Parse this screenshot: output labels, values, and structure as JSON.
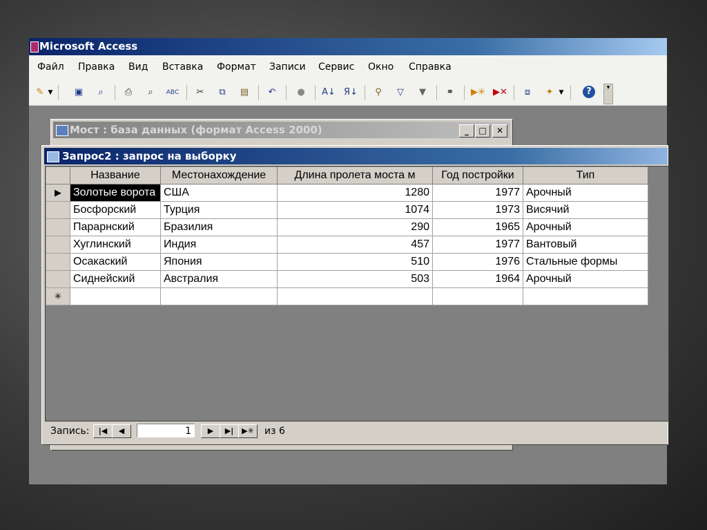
{
  "app": {
    "title": "Microsoft Access"
  },
  "menu": [
    "Файл",
    "Правка",
    "Вид",
    "Вставка",
    "Формат",
    "Записи",
    "Сервис",
    "Окно",
    "Справка"
  ],
  "toolbar": {
    "icons": [
      "design-view-icon",
      "save-icon",
      "search-icon",
      "print-icon",
      "print-preview-icon",
      "spelling-icon",
      "cut-icon",
      "copy-icon",
      "paste-icon",
      "undo-icon",
      "hyperlink-icon",
      "sort-ascending-icon",
      "sort-descending-icon",
      "filter-by-selection-icon",
      "filter-by-form-icon",
      "apply-filter-icon",
      "find-icon",
      "new-record-icon",
      "delete-record-icon",
      "database-window-icon",
      "new-object-icon",
      "help-icon"
    ]
  },
  "db_window": {
    "title": "Мост : база данных (формат Access 2000)"
  },
  "query_window": {
    "title": "Запрос2 : запрос на выборку",
    "columns": [
      "Название",
      "Местонахождение",
      "Длина пролета моста м",
      "Год постройки",
      "Тип"
    ],
    "rows": [
      [
        "Золотые ворота",
        "США",
        "1280",
        "1977",
        "Арочный"
      ],
      [
        "Босфорский",
        "Турция",
        "1074",
        "1973",
        "Висячий"
      ],
      [
        "Парарнский",
        "Бразилия",
        "290",
        "1965",
        "Арочный"
      ],
      [
        "Хуглинский",
        "Индия",
        "457",
        "1977",
        "Вантовый"
      ],
      [
        "Осакаский",
        "Япония",
        "510",
        "1976",
        "Стальные формы"
      ],
      [
        "Сиднейский",
        "Австралия",
        "503",
        "1964",
        "Арочный"
      ]
    ],
    "new_row_marker": "✳",
    "current_row_marker": "▶"
  },
  "navigation": {
    "label": "Запись:",
    "current": "1",
    "of_text": "из  6",
    "first": "|◀",
    "prev": "◀",
    "next": "▶",
    "last": "▶|",
    "new": "▶✳"
  },
  "window_buttons": {
    "minimize": "_",
    "maximize": "□",
    "close": "✕"
  }
}
